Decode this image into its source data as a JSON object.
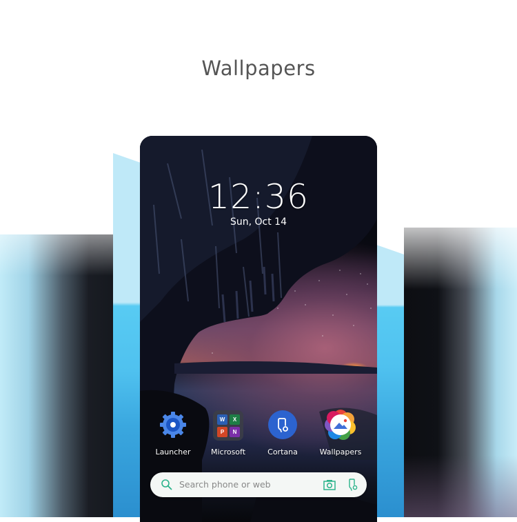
{
  "page": {
    "title": "Wallpapers"
  },
  "lockscreen": {
    "time": "12:36",
    "date": "Sun, Oct 14"
  },
  "dock": {
    "items": [
      {
        "label": "Launcher",
        "icon": "gear-icon",
        "color": "#4a86e8"
      },
      {
        "label": "Microsoft",
        "icon": "folder-icon",
        "apps": [
          {
            "name": "Word",
            "letter": "W",
            "color": "#2b5fb3"
          },
          {
            "name": "Excel",
            "letter": "X",
            "color": "#1e7e45"
          },
          {
            "name": "PowerPoint",
            "letter": "P",
            "color": "#d24726"
          },
          {
            "name": "OneNote",
            "letter": "N",
            "color": "#7b2fa8"
          }
        ]
      },
      {
        "label": "Cortana",
        "icon": "cortana-icon",
        "color": "#2c63cf"
      },
      {
        "label": "Wallpapers",
        "icon": "wallpapers-icon"
      }
    ]
  },
  "search": {
    "placeholder": "Search phone or web",
    "accent_color": "#2bb38b"
  },
  "colors": {
    "title": "#555555",
    "band_light": "#bfe9f8",
    "band_blue": "#4fc1ef"
  }
}
